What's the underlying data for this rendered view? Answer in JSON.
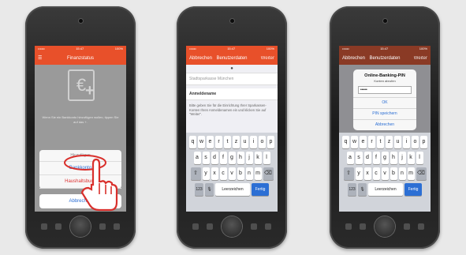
{
  "phone1": {
    "status": {
      "carrier": "•••oo",
      "time": "15:47",
      "battery": "100%"
    },
    "nav_title": "Finanzstatus",
    "info_text": "Wenn Sie ein Bankkonto hinzufügen wollen, tippen Sie auf das +.",
    "sheet_title": "Hinzufügen",
    "option_bank": "Bankkonto",
    "option_household": "Haushaltsbuch",
    "cancel": "Abbrechen"
  },
  "phone2": {
    "status": {
      "carrier": "•••oo",
      "time": "15:47",
      "battery": "100%"
    },
    "nav_left": "Abbrechen",
    "nav_title": "Benutzerdaten",
    "nav_right": "Weiter",
    "page_dot": "●",
    "bank_field": "Stadtsparkasse München",
    "login_label": "Anmeldename",
    "help_text": "Bitte geben Sie für die Einrichtung Ihrer Sparkassen-Konten Ihren Anmeldenamen ein und klicken Sie auf \"Weiter\"."
  },
  "phone3": {
    "status": {
      "carrier": "•••oo",
      "time": "15:47",
      "battery": "100%"
    },
    "nav_left": "Abbrechen",
    "nav_title": "Benutzerdaten",
    "nav_right": "Weiter",
    "alert_title": "Online-Banking-PIN",
    "alert_subtitle": "Konten abrufen",
    "pin_value": "•••••",
    "btn_ok": "OK",
    "btn_save": "PIN speichern",
    "btn_cancel": "Abbrechen"
  },
  "keyboard": {
    "row1": [
      "q",
      "w",
      "e",
      "r",
      "t",
      "z",
      "u",
      "i",
      "o",
      "p"
    ],
    "row2": [
      "a",
      "s",
      "d",
      "f",
      "g",
      "h",
      "j",
      "k",
      "l"
    ],
    "row3": [
      "y",
      "x",
      "c",
      "v",
      "b",
      "n",
      "m"
    ],
    "shift": "⇧",
    "backspace": "⌫",
    "num": "123",
    "mic": "🎙",
    "space": "Leerzeichen",
    "done": "Fertig"
  },
  "colors": {
    "accent": "#e8502a",
    "link": "#2c6fd4",
    "hand": "#d9302c"
  }
}
